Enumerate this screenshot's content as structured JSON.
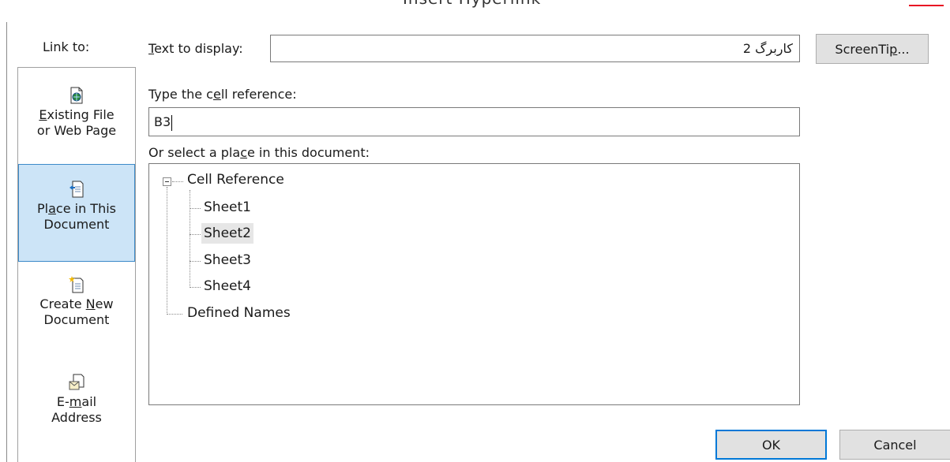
{
  "dialog": {
    "title": "Insert Hyperlink",
    "link_to_label": "Link to:"
  },
  "nav": {
    "items": [
      {
        "label_line1": "Existing File",
        "label_line2": "or Web Page",
        "icon": "existing-file-icon",
        "selected": false
      },
      {
        "label_line1": "Place in This",
        "label_line2": "Document",
        "icon": "place-in-document-icon",
        "selected": true
      },
      {
        "label_line1": "Create New",
        "label_line2": "Document",
        "icon": "create-new-document-icon",
        "selected": false
      },
      {
        "label_line1": "E-mail",
        "label_line2": "Address",
        "icon": "email-address-icon",
        "selected": false
      }
    ]
  },
  "text_to_display": {
    "label": "Text to display:",
    "value": "کاربرگ 2"
  },
  "screentip_button": "ScreenTip...",
  "cell_reference": {
    "label": "Type the cell reference:",
    "value": "B3"
  },
  "place": {
    "label": "Or select a place in this document:",
    "tree": {
      "root": "Cell Reference",
      "sheets": [
        "Sheet1",
        "Sheet2",
        "Sheet3",
        "Sheet4"
      ],
      "selected": "Sheet2",
      "defined_names": "Defined Names"
    }
  },
  "buttons": {
    "ok": "OK",
    "cancel": "Cancel"
  },
  "colors": {
    "selected_nav_bg": "#cce4f7",
    "selected_nav_border": "#3c8ac9",
    "default_button_border": "#0078d7",
    "close_accent": "#e81123"
  }
}
